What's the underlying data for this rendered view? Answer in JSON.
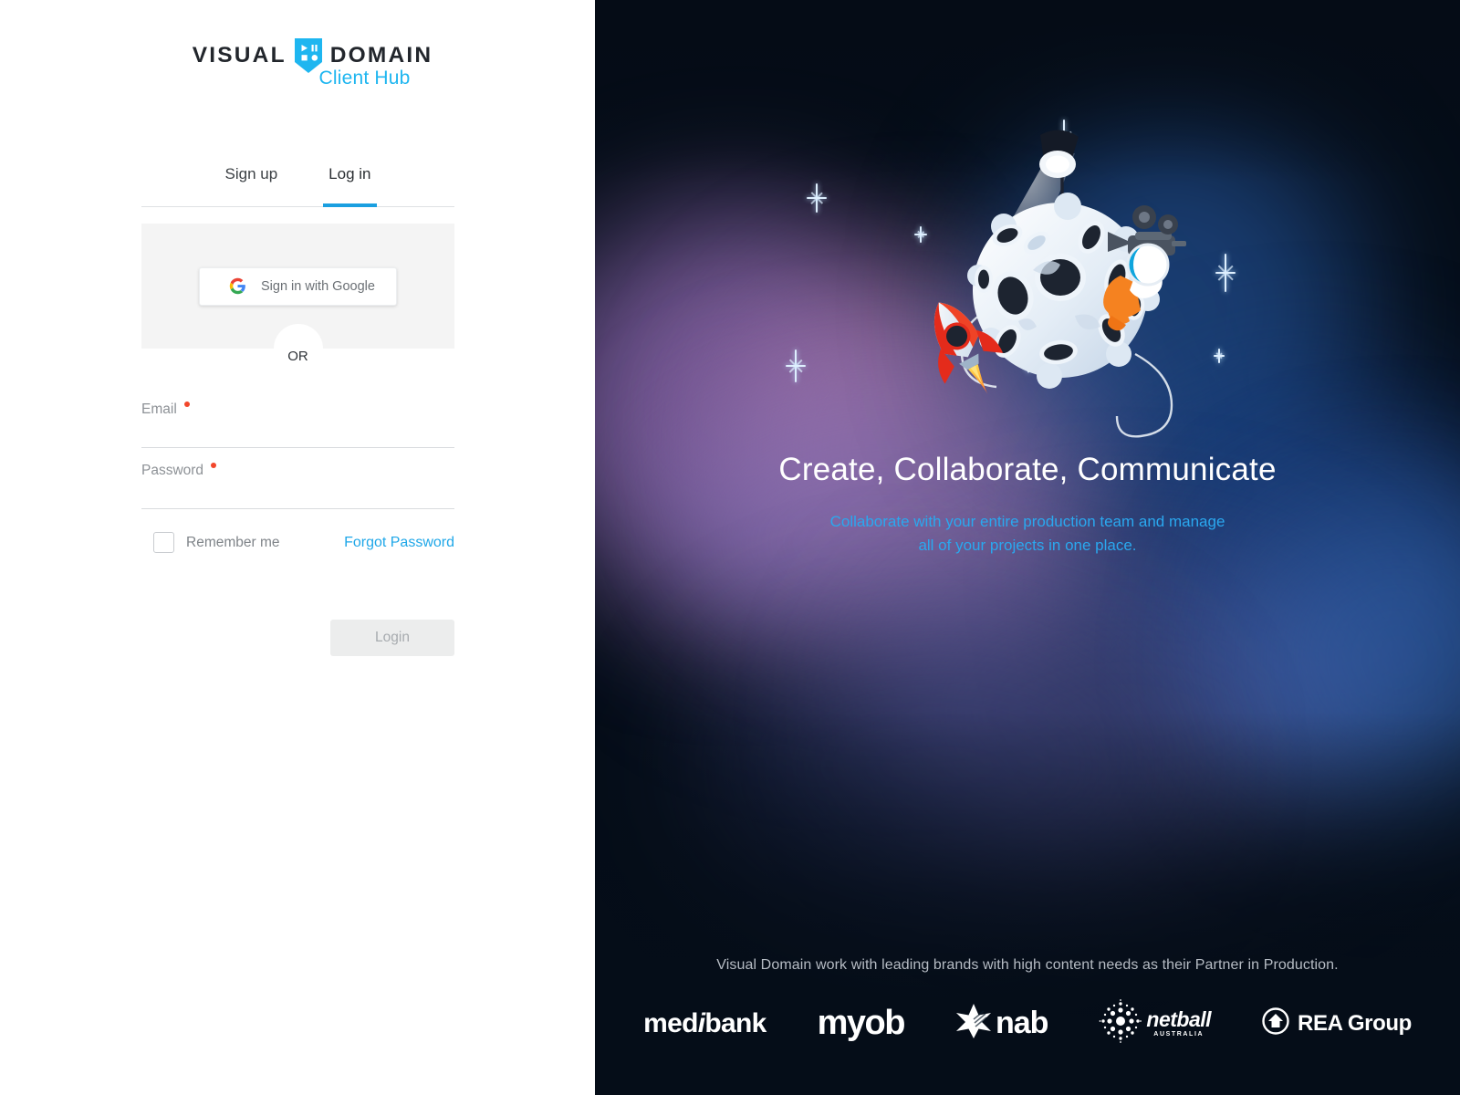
{
  "brand": {
    "word_left": "VISUAL",
    "word_right": "DOMAIN",
    "sub": "Client Hub",
    "mark_icon": "shield-play-pause-icon",
    "accent": "#1eb6f0"
  },
  "tabs": [
    {
      "label": "Sign up",
      "active": false
    },
    {
      "label": "Log in",
      "active": true
    }
  ],
  "social": {
    "google_label": "Sign in with Google",
    "google_icon": "google-g-icon",
    "divider_label": "OR"
  },
  "form": {
    "email": {
      "label": "Email",
      "value": "",
      "placeholder": "",
      "required": true
    },
    "password": {
      "label": "Password",
      "value": "",
      "placeholder": "",
      "required": true
    },
    "remember_label": "Remember me",
    "remember_checked": false,
    "forgot_label": "Forgot Password",
    "submit_label": "Login",
    "submit_disabled": true,
    "required_dot_color": "#f2462b",
    "link_color": "#1fa7e8"
  },
  "hero": {
    "headline": "Create, Collaborate, Communicate",
    "sub_line1": "Collaborate with your entire production team and manage",
    "sub_line2": "all of your projects in one place.",
    "sub_color": "#2aa8ef",
    "illustration": "moon-rocket-astronaut-spotlight-illustration"
  },
  "footer": {
    "tagline": "Visual Domain work with leading brands with high content needs as their Partner in Production.",
    "brands": [
      {
        "name": "medibank",
        "text_a": "med",
        "text_b": "i",
        "text_c": "bank",
        "icon": "medibank-wordmark"
      },
      {
        "name": "myob",
        "text": "myob",
        "icon": "myob-wordmark"
      },
      {
        "name": "nab",
        "text": "nab",
        "icon": "nab-star-icon"
      },
      {
        "name": "netball",
        "text": "netball",
        "sub": "AUSTRALIA",
        "icon": "netball-dots-icon"
      },
      {
        "name": "rea-group",
        "text": "REA Group",
        "icon": "rea-house-icon"
      }
    ]
  }
}
